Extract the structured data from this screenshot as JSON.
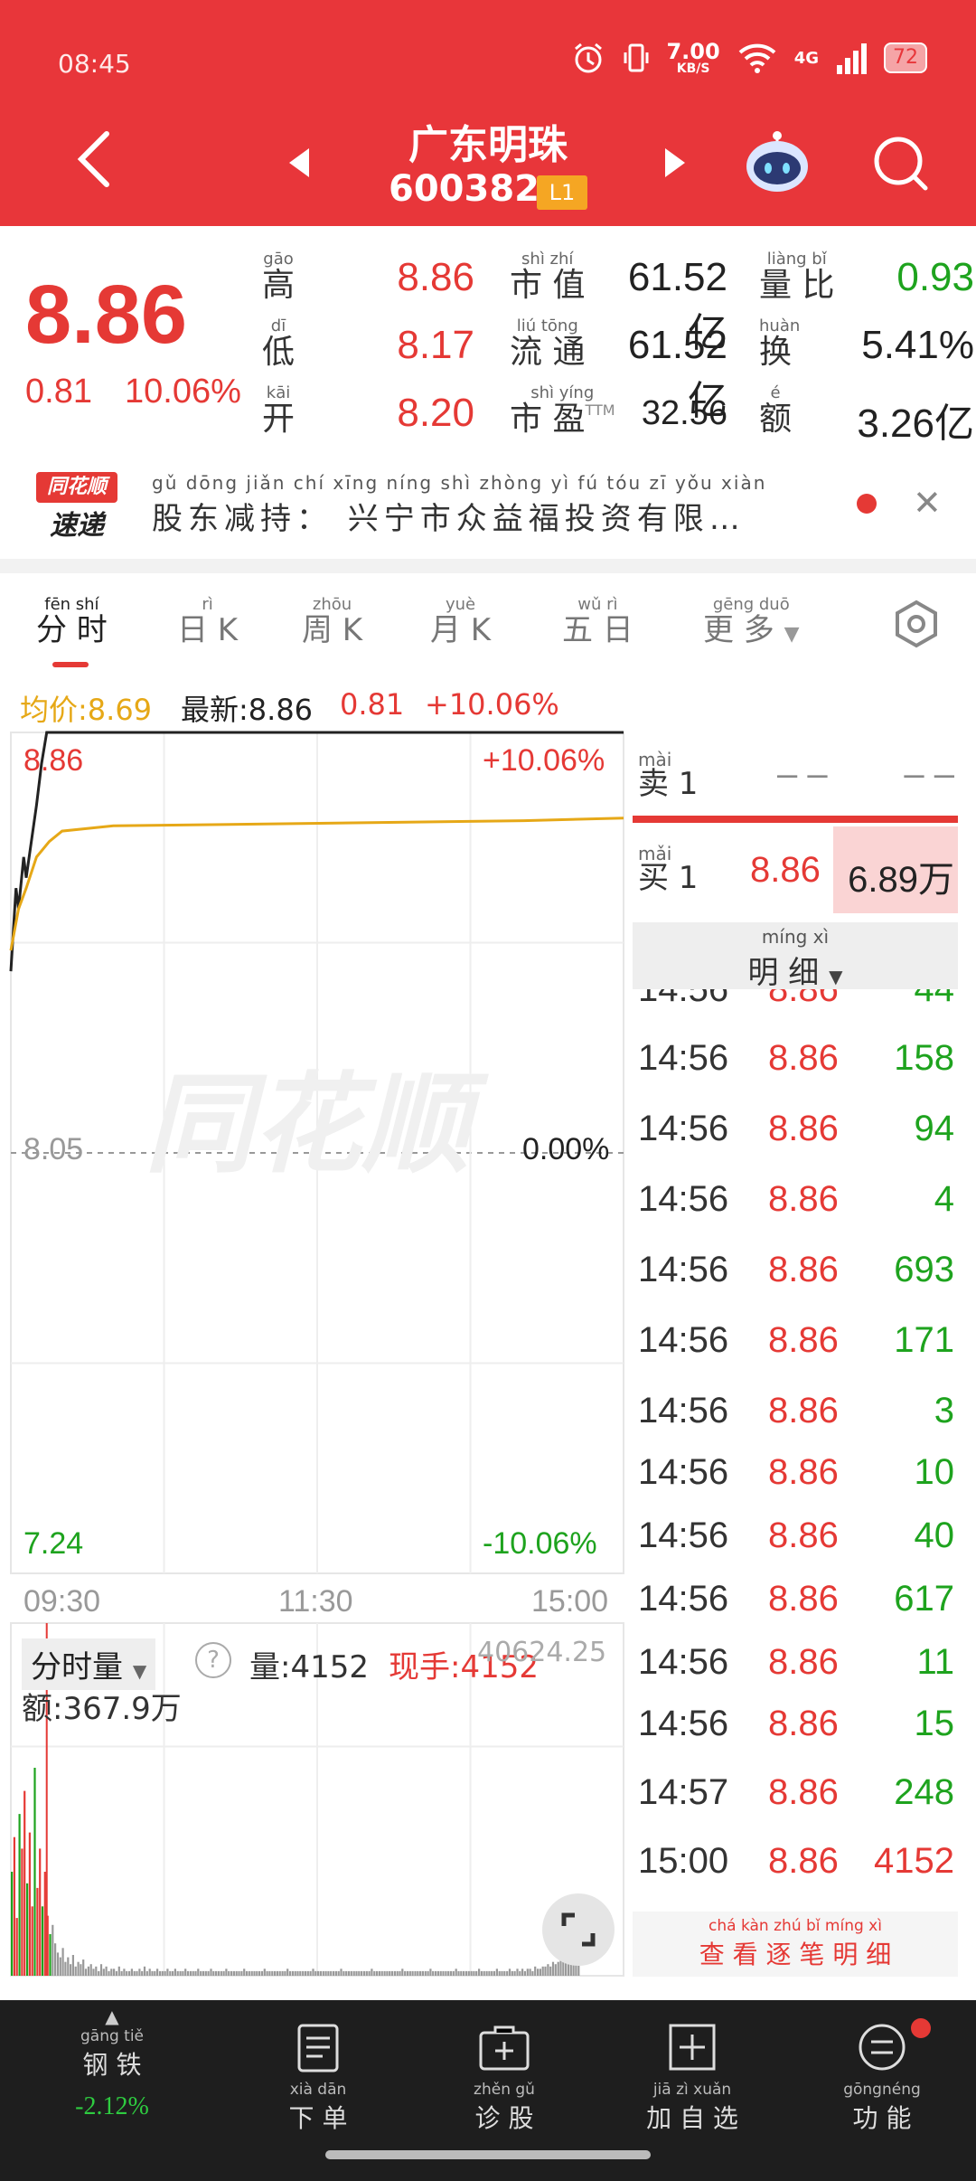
{
  "status_bar": {
    "time": "08:45",
    "net_speed": "7.00",
    "net_unit": "KB/S",
    "network": "4G",
    "battery": "72"
  },
  "header": {
    "stock_name": "广东明珠",
    "stock_code": "600382",
    "level_badge": "L1"
  },
  "quote": {
    "price": "8.86",
    "change": "0.81",
    "change_pct": "10.06%",
    "fields": [
      {
        "pinyin": "gāo",
        "label": "高",
        "value": "8.86",
        "color": "#e53935"
      },
      {
        "pinyin": "dī",
        "label": "低",
        "value": "8.17",
        "color": "#e53935"
      },
      {
        "pinyin": "kāi",
        "label": "开",
        "value": "8.20",
        "color": "#e53935"
      },
      {
        "pinyin": "shì zhí",
        "label": "市 值",
        "value": "61.52亿",
        "color": "#222222"
      },
      {
        "pinyin": "liú tōng",
        "label": "流 通",
        "value": "61.52亿",
        "color": "#222222"
      },
      {
        "pinyin": "shì yíng",
        "label": "市 盈",
        "suffix": "TTM",
        "value": "32.56",
        "color": "#222222"
      },
      {
        "pinyin": "liàng bǐ",
        "label": "量 比",
        "value": "0.93",
        "color": "#1ea31e"
      },
      {
        "pinyin": "huàn",
        "label": "换",
        "value": "5.41%",
        "color": "#222222"
      },
      {
        "pinyin": "é",
        "label": "额",
        "value": "3.26亿",
        "color": "#222222"
      }
    ]
  },
  "news": {
    "logo_top": "同花顺",
    "logo_bottom": "速递",
    "pinyin": "gǔ dōng jiǎn chí    xīng níng shì zhòng yì  fú  tóu  zī  yǒu xiàn",
    "text": "股东减持： 兴宁市众益福投资有限…"
  },
  "tabs": [
    {
      "pinyin": "fēn shí",
      "label": "分 时",
      "active": true
    },
    {
      "pinyin": "rì",
      "label": "日 K"
    },
    {
      "pinyin": "zhōu",
      "label": "周 K"
    },
    {
      "pinyin": "yuè",
      "label": "月 K"
    },
    {
      "pinyin": "wǔ  rì",
      "label": "五 日"
    },
    {
      "pinyin": "gēng duō",
      "label": "更 多"
    }
  ],
  "info_line": {
    "avg_label": "均价:8.69",
    "latest_label": "最新:8.86",
    "change": "0.81",
    "change_pct": "+10.06%"
  },
  "chart_data": {
    "type": "line",
    "y_max": 8.86,
    "y_min": 7.24,
    "y_mid": 8.05,
    "pct_max": "+10.06%",
    "pct_mid": "0.00%",
    "pct_min": "-10.06%",
    "xlabels": [
      "09:30",
      "11:30",
      "15:00"
    ],
    "watermark": "同花顺",
    "series": [
      {
        "name": "最新",
        "color": "#222222",
        "points": [
          [
            0,
            8.4
          ],
          [
            2,
            8.56
          ],
          [
            3,
            8.52
          ],
          [
            5,
            8.62
          ],
          [
            6,
            8.58
          ],
          [
            8,
            8.65
          ],
          [
            10,
            8.72
          ],
          [
            12,
            8.8
          ],
          [
            14,
            8.86
          ],
          [
            239,
            8.86
          ]
        ]
      },
      {
        "name": "均价",
        "color": "#e6a817",
        "points": [
          [
            0,
            8.44
          ],
          [
            3,
            8.52
          ],
          [
            6,
            8.56
          ],
          [
            10,
            8.62
          ],
          [
            15,
            8.65
          ],
          [
            20,
            8.67
          ],
          [
            40,
            8.68
          ],
          [
            120,
            8.685
          ],
          [
            200,
            8.69
          ],
          [
            239,
            8.695
          ]
        ]
      }
    ],
    "volume_header": {
      "selector": "分时量",
      "volume": "量:4152",
      "current_hand": "现手:4152",
      "amount": "额:367.9万",
      "top_right": "40624.25"
    },
    "volumes": [
      45,
      60,
      25,
      70,
      55,
      80,
      40,
      62,
      30,
      90,
      38,
      55,
      30,
      45,
      26,
      18,
      22,
      14,
      10,
      8,
      12,
      6,
      8,
      5,
      9,
      4,
      6,
      5,
      7,
      3,
      4,
      5,
      3,
      4,
      2,
      5,
      3,
      4,
      2,
      3,
      3,
      2,
      4,
      2,
      3,
      2,
      2,
      3,
      2,
      2,
      3,
      2,
      4,
      2,
      3,
      2,
      2,
      3,
      2,
      2,
      2,
      3,
      2,
      2,
      3,
      2,
      2,
      2,
      3,
      2,
      2,
      2,
      2,
      3,
      2,
      2,
      2,
      2,
      3,
      2,
      2,
      2,
      2,
      2,
      3,
      2,
      2,
      2,
      2,
      2,
      2,
      3,
      2,
      2,
      2,
      2,
      2,
      2,
      2,
      3,
      2,
      2,
      2,
      2,
      2,
      2,
      2,
      2,
      3,
      2,
      2,
      2,
      2,
      2,
      2,
      2,
      2,
      2,
      3,
      2,
      2,
      2,
      2,
      2,
      2,
      2,
      2,
      2,
      2,
      3,
      2,
      2,
      2,
      2,
      2,
      2,
      2,
      2,
      2,
      2,
      2,
      3,
      2,
      2,
      2,
      2,
      2,
      2,
      2,
      2,
      2,
      2,
      2,
      3,
      2,
      2,
      2,
      2,
      2,
      2,
      2,
      2,
      2,
      2,
      3,
      2,
      2,
      2,
      2,
      2,
      2,
      2,
      2,
      2,
      3,
      2,
      2,
      2,
      2,
      2,
      2,
      2,
      2,
      3,
      2,
      2,
      2,
      2,
      2,
      2,
      3,
      2,
      2,
      2,
      2,
      3,
      2,
      2,
      3,
      2,
      3,
      2,
      3,
      3,
      2,
      4,
      3,
      3,
      4,
      4,
      5,
      4,
      6,
      5,
      6,
      7,
      6,
      8,
      10,
      12,
      9,
      14,
      16
    ]
  },
  "order_book": {
    "sell_pinyin": "mài",
    "sell_label": "卖 1",
    "sell_price": "– –",
    "sell_vol": "– –",
    "buy_pinyin": "mǎi",
    "buy_label": "买 1",
    "buy_price": "8.86",
    "buy_vol": "6.89万",
    "detail_pinyin": "míng  xì",
    "detail_label": "明 细",
    "trades": [
      {
        "time": "14:56",
        "price": "8.86",
        "vol": "158",
        "color": "#1ea31e"
      },
      {
        "time": "14:56",
        "price": "8.86",
        "vol": "94",
        "color": "#1ea31e"
      },
      {
        "time": "14:56",
        "price": "8.86",
        "vol": "4",
        "color": "#1ea31e"
      },
      {
        "time": "14:56",
        "price": "8.86",
        "vol": "693",
        "color": "#1ea31e"
      },
      {
        "time": "14:56",
        "price": "8.86",
        "vol": "171",
        "color": "#1ea31e"
      },
      {
        "time": "14:56",
        "price": "8.86",
        "vol": "3",
        "color": "#1ea31e"
      },
      {
        "time": "14:56",
        "price": "8.86",
        "vol": "10",
        "color": "#1ea31e"
      },
      {
        "time": "14:56",
        "price": "8.86",
        "vol": "40",
        "color": "#1ea31e"
      },
      {
        "time": "14:56",
        "price": "8.86",
        "vol": "617",
        "color": "#1ea31e"
      },
      {
        "time": "14:56",
        "price": "8.86",
        "vol": "11",
        "color": "#1ea31e"
      },
      {
        "time": "14:56",
        "price": "8.86",
        "vol": "15",
        "color": "#1ea31e"
      },
      {
        "time": "14:57",
        "price": "8.86",
        "vol": "248",
        "color": "#1ea31e"
      },
      {
        "time": "15:00",
        "price": "8.86",
        "vol": "4152",
        "color": "#e53935"
      }
    ],
    "partial_row": {
      "time": "14:56",
      "price": "8.86",
      "vol": "44"
    },
    "view_all_pinyin": "chá kàn zhú  bǐ  míng  xì",
    "view_all": "查 看 逐 笔 明 细"
  },
  "bottom_bar": {
    "sector_pinyin": "gāng tiě",
    "sector": "钢 铁",
    "sector_change": "-2.12%",
    "items": [
      {
        "pinyin": "xià dān",
        "label": "下 单",
        "icon": "order-doc-icon"
      },
      {
        "pinyin": "zhěn gǔ",
        "label": "诊 股",
        "icon": "diagnose-icon"
      },
      {
        "pinyin": "jiā  zì  xuǎn",
        "label": "加 自 选",
        "icon": "add-watchlist-icon"
      },
      {
        "pinyin": "gōngnéng",
        "label": "功 能",
        "icon": "menu-icon"
      }
    ]
  }
}
